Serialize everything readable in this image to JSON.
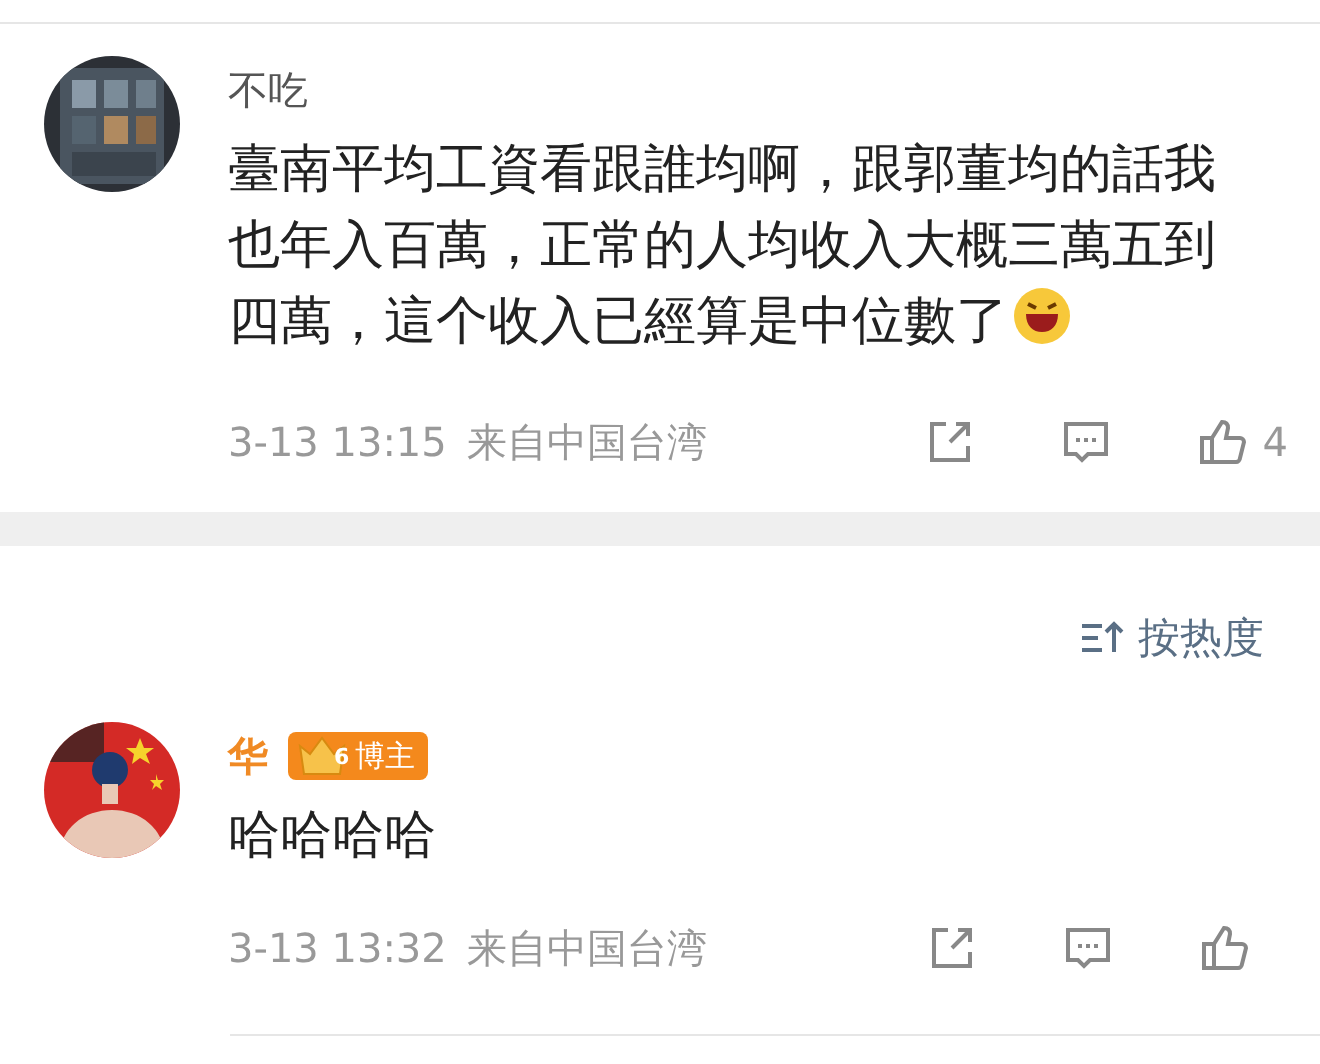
{
  "comments": [
    {
      "user": "不吃",
      "vip": false,
      "text": "臺南平均工資看跟誰均啊，跟郭董均的話我也年入百萬，正常的人均收入大概三萬五到四萬，這个收入已經算是中位數了",
      "emoji": true,
      "time": "3-13 13:15",
      "location": "来自中国台湾",
      "likes": "4"
    }
  ],
  "sort": {
    "label": "按热度"
  },
  "replies": [
    {
      "user": "华",
      "vip": true,
      "badge": {
        "level": "6",
        "label": "博主"
      },
      "text": "哈哈哈哈",
      "emoji": false,
      "time": "3-13 13:32",
      "location": "来自中国台湾"
    }
  ]
}
